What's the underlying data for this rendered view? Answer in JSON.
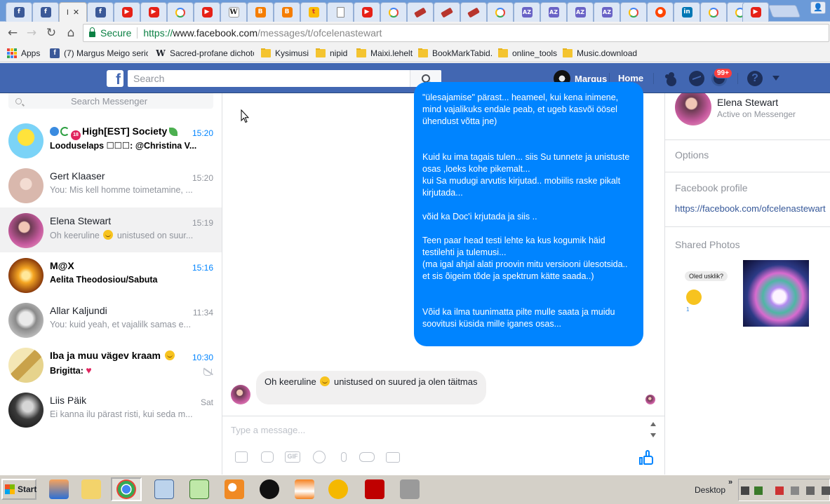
{
  "browser": {
    "active_tab_label": "I",
    "close_glyph": "✕",
    "secure_label": "Secure",
    "url_proto": "https://",
    "url_host": "www.facebook.com",
    "url_path": "/messages/t/ofcelenastewart",
    "bookmarks": [
      {
        "label": "Apps",
        "icon": "apps-icon"
      },
      {
        "label": "(7) Margus Meigo seriou",
        "icon": "facebook-icon"
      },
      {
        "label": "Sacred-profane dichoto",
        "icon": "wikipedia-icon"
      },
      {
        "label": "Kysimusi",
        "icon": "folder-icon"
      },
      {
        "label": "nipid",
        "icon": "folder-icon"
      },
      {
        "label": "Maixi.lehelt",
        "icon": "folder-icon"
      },
      {
        "label": "BookMarkTabid.",
        "icon": "folder-icon"
      },
      {
        "label": "online_tools",
        "icon": "folder-icon"
      },
      {
        "label": "Music.download",
        "icon": "folder-icon"
      }
    ]
  },
  "fb": {
    "logo": "f",
    "search_placeholder": "Search",
    "user_name": "Margus",
    "home_label": "Home",
    "notif_badge": "99+",
    "help_glyph": "?"
  },
  "messenger": {
    "search_placeholder": "Search Messenger",
    "conversations": [
      {
        "name": "High[EST] Society",
        "preview": "Looduselaps ☐☐☐: @Christina V...",
        "time": "15:20",
        "unread": true
      },
      {
        "name": "Gert Klaaser",
        "preview": "You: Mis kell homme toimetamine, ...",
        "time": "15:20",
        "unread": false
      },
      {
        "name": "Elena Stewart",
        "preview_a": "Oh keeruline",
        "preview_b": "unistused on suur...",
        "time": "15:19",
        "unread": false,
        "selected": true
      },
      {
        "name": "M@X",
        "preview": "Aelita Theodosiou/Sabuta",
        "time": "15:16",
        "unread": true
      },
      {
        "name": "Allar Kaljundi",
        "preview": "You: kuid yeah, et vajalilk samas e...",
        "time": "11:34",
        "unread": false
      },
      {
        "name": "Iba ja muu vägev kraam",
        "preview": "Brigitta:",
        "time": "10:30",
        "unread": true
      },
      {
        "name": "Liis Päik",
        "preview": "Ei kanna ilu pärast risti, kui seda m...",
        "time": "Sat",
        "unread": false
      }
    ]
  },
  "chat": {
    "outgoing_message": "\"ülesajamise\" pärast... heameel, kui kena inimene, mind vajalikuks endale peab, et ugeb kasvõi öösel ühendust võtta jne)\n\n\nKuid ku ima tagais tulen... siis Su tunnete ja unistuste osas ,loeks kohe pikemalt...\nkui Sa mudugi arvutis kirjutad.. mobiilis raske pikalt kirjutada...\n\nvõid ka Doc'i krjutada ja siis ..\n\nTeen paar head testi lehte ka kus kogumik häid testilehti ja tulemusi...\n(ma igal ahjal alati proovin mitu versiooni ülesotsida.. et sis õigeim tõde ja spektrum kätte saada..)\n\n\nVõid ka ilma tuunimatta pilte mulle saata ja muidu soovitusi küsida mille iganes osas...",
    "incoming_a": "Oh keeruline",
    "incoming_b": "unistused on suured ja olen täitmas",
    "composer_placeholder": "Type a message...",
    "gif_label": "GIF"
  },
  "info": {
    "name": "Elena Stewart",
    "status": "Active on Messenger",
    "options_label": "Options",
    "profile_label": "Facebook profile",
    "profile_link": "https://facebook.com/ofcelenastewart",
    "photos_label": "Shared Photos",
    "sticker_text": "Oled usklik?",
    "sticker_reaction": "1"
  },
  "taskbar": {
    "start_label": "Start",
    "desktop_label": "Desktop",
    "chevron": "»"
  },
  "colors": {
    "fb_blue": "#4267b2",
    "messenger_blue": "#0084ff",
    "unread_time": "#0084ff"
  }
}
